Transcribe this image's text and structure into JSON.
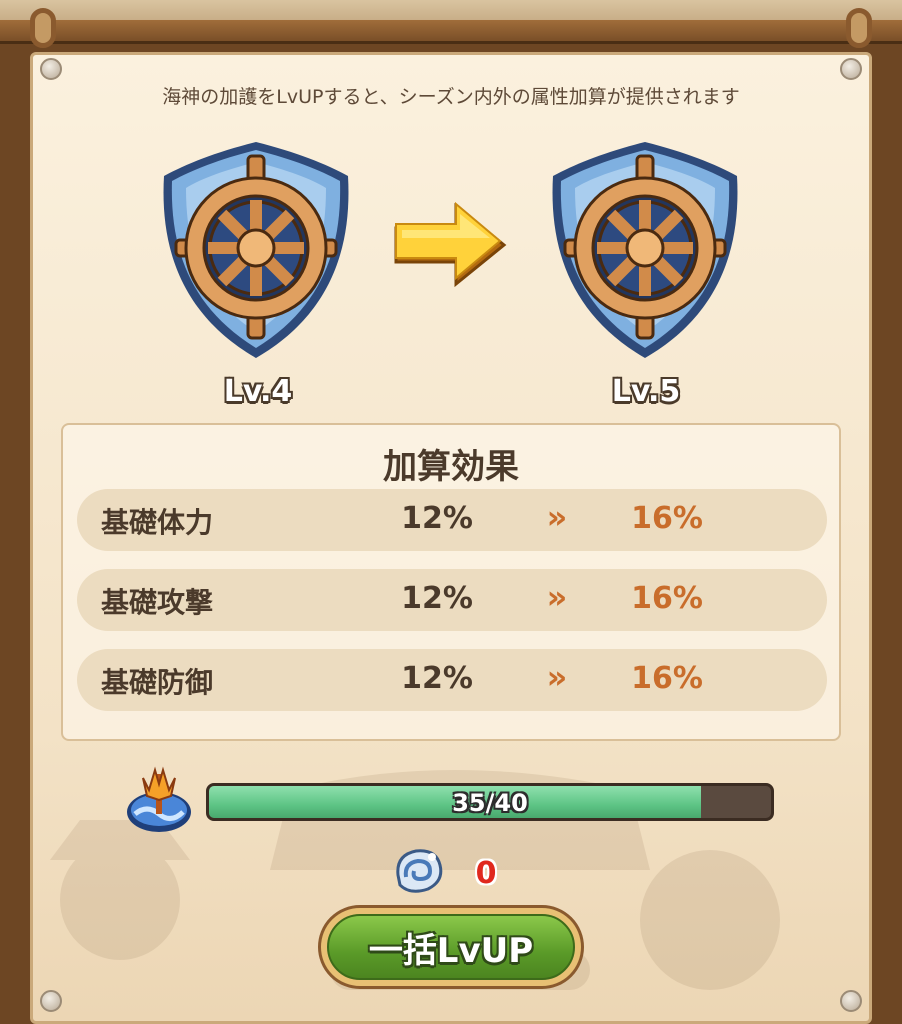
{
  "description": "海神の加護をLvUPすると、シーズン内外の属性加算が提供されます",
  "upgrade": {
    "current_level": "Lv.4",
    "next_level": "Lv.5",
    "emblem_icon": "ship-wheel-shield-icon",
    "arrow_icon": "right-arrow-icon"
  },
  "effects": {
    "title": "加算効果",
    "separator": "»",
    "rows": [
      {
        "name": "基礎体力",
        "current": "12%",
        "next": "16%"
      },
      {
        "name": "基礎攻撃",
        "current": "12%",
        "next": "16%"
      },
      {
        "name": "基礎防御",
        "current": "12%",
        "next": "16%"
      }
    ]
  },
  "progress": {
    "icon": "trident-icon",
    "text": "35/40",
    "current": 35,
    "max": 40
  },
  "cost": {
    "icon": "seashell-icon",
    "value": "0"
  },
  "button": {
    "label": "一括LvUP"
  },
  "colors": {
    "accent_orange": "#c96d2b",
    "progress_green": "#5dc485",
    "cost_red": "#e0281e",
    "button_green": "#5a9a28"
  }
}
